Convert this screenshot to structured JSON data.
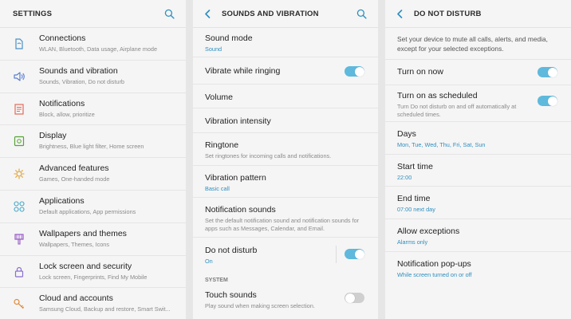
{
  "colors": {
    "accent": "#2d8fbf",
    "toggle_on": "#5eb9dd",
    "toggle_off": "#cfcfcf"
  },
  "settings": {
    "title": "SETTINGS",
    "items": [
      {
        "icon": "connections-icon",
        "label": "Connections",
        "sub": "WLAN, Bluetooth, Data usage, Airplane mode"
      },
      {
        "icon": "speaker-icon",
        "label": "Sounds and vibration",
        "sub": "Sounds, Vibration, Do not disturb"
      },
      {
        "icon": "notifications-icon",
        "label": "Notifications",
        "sub": "Block, allow, prioritize"
      },
      {
        "icon": "display-icon",
        "label": "Display",
        "sub": "Brightness, Blue light filter, Home screen"
      },
      {
        "icon": "advanced-features-icon",
        "label": "Advanced features",
        "sub": "Games, One-handed mode"
      },
      {
        "icon": "applications-icon",
        "label": "Applications",
        "sub": "Default applications, App permissions"
      },
      {
        "icon": "wallpapers-icon",
        "label": "Wallpapers and themes",
        "sub": "Wallpapers, Themes, Icons"
      },
      {
        "icon": "lock-icon",
        "label": "Lock screen and security",
        "sub": "Lock screen, Fingerprints, Find My Mobile"
      },
      {
        "icon": "key-icon",
        "label": "Cloud and accounts",
        "sub": "Samsung Cloud, Backup and restore, Smart Swit..."
      }
    ]
  },
  "sounds": {
    "title": "SOUNDS AND VIBRATION",
    "sound_mode": {
      "label": "Sound mode",
      "value": "Sound"
    },
    "vibrate_while_ringing": {
      "label": "Vibrate while ringing",
      "on": true
    },
    "volume": {
      "label": "Volume"
    },
    "vibration_intensity": {
      "label": "Vibration intensity"
    },
    "ringtone": {
      "label": "Ringtone",
      "sub": "Set ringtones for incoming calls and notifications."
    },
    "vibration_pattern": {
      "label": "Vibration pattern",
      "value": "Basic call"
    },
    "notification_sounds": {
      "label": "Notification sounds",
      "sub": "Set the default notification sound and notification sounds for apps such as Messages, Calendar, and Email."
    },
    "do_not_disturb": {
      "label": "Do not disturb",
      "value": "On",
      "on": true
    },
    "section_system": "SYSTEM",
    "touch_sounds": {
      "label": "Touch sounds",
      "sub": "Play sound when making screen selection.",
      "on": false
    }
  },
  "dnd": {
    "title": "DO NOT DISTURB",
    "intro": "Set your device to mute all calls, alerts, and media, except for your selected exceptions.",
    "turn_on_now": {
      "label": "Turn on now",
      "on": true
    },
    "scheduled": {
      "label": "Turn on as scheduled",
      "sub": "Turn Do not disturb on and off automatically at scheduled times.",
      "on": true
    },
    "days": {
      "label": "Days",
      "value": "Mon, Tue, Wed, Thu, Fri, Sat, Sun"
    },
    "start_time": {
      "label": "Start time",
      "value": "22:00"
    },
    "end_time": {
      "label": "End time",
      "value": "07:00 next day"
    },
    "allow_exceptions": {
      "label": "Allow exceptions",
      "value": "Alarms only"
    },
    "popups": {
      "label": "Notification pop-ups",
      "value": "While screen turned on or off"
    }
  }
}
